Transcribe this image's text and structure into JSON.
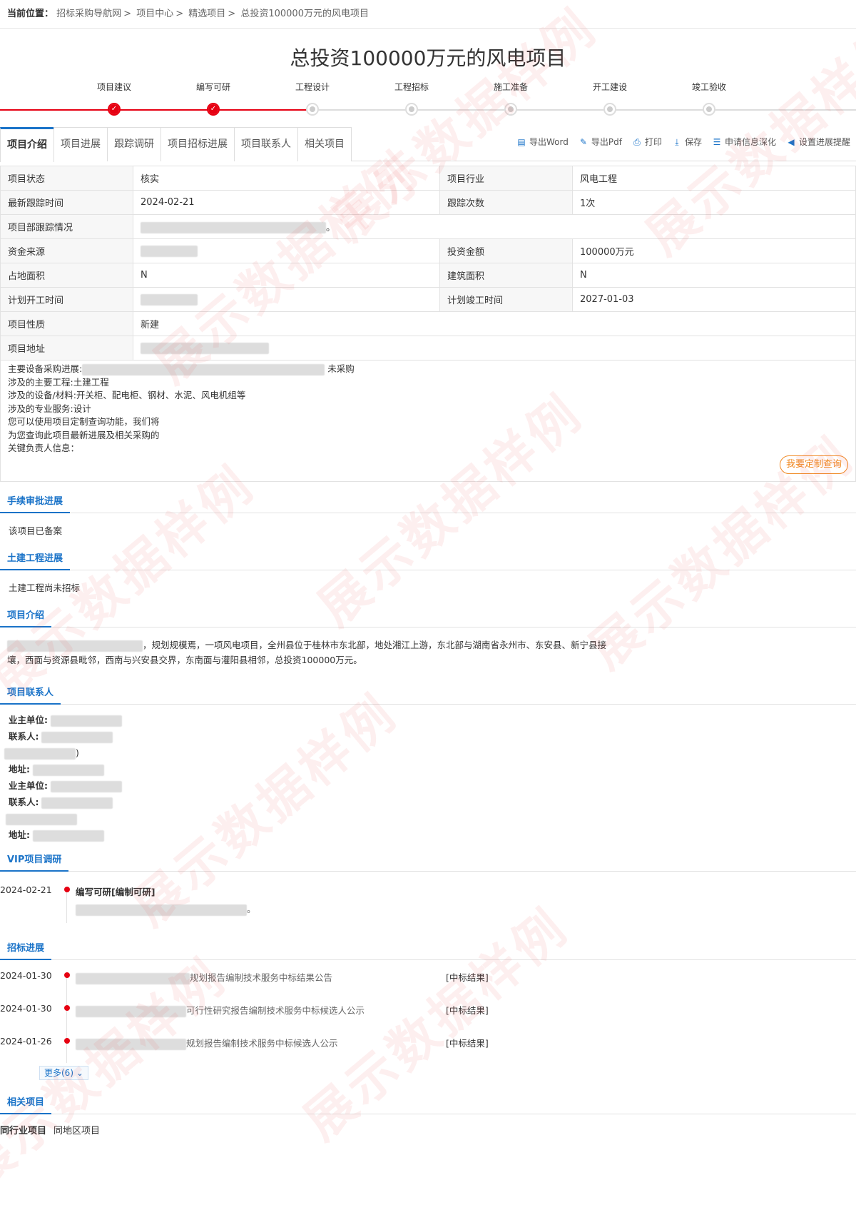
{
  "breadcrumb": {
    "prefix": "当前位置：",
    "items": [
      "招标采购导航网",
      "项目中心",
      "精选项目",
      "总投资100000万元的风电项目"
    ]
  },
  "page_title": "总投资100000万元的风电项目",
  "stepper": {
    "steps": [
      {
        "label": "项目建议",
        "done": true
      },
      {
        "label": "编写可研",
        "done": true
      },
      {
        "label": "工程设计",
        "done": false
      },
      {
        "label": "工程招标",
        "done": false
      },
      {
        "label": "施工准备",
        "done": false
      },
      {
        "label": "开工建设",
        "done": false
      },
      {
        "label": "竣工验收",
        "done": false
      }
    ],
    "completed_count": 2
  },
  "tabs": [
    {
      "label": "项目介绍",
      "active": true
    },
    {
      "label": "项目进展",
      "active": false
    },
    {
      "label": "跟踪调研",
      "active": false
    },
    {
      "label": "项目招标进展",
      "active": false
    },
    {
      "label": "项目联系人",
      "active": false
    },
    {
      "label": "相关项目",
      "active": false
    }
  ],
  "tools": [
    {
      "label": "导出Word",
      "icon": "word-icon"
    },
    {
      "label": "导出Pdf",
      "icon": "pdf-icon"
    },
    {
      "label": "打印",
      "icon": "print-icon"
    },
    {
      "label": "保存",
      "icon": "save-icon"
    },
    {
      "label": "申请信息深化",
      "icon": "apply-icon"
    },
    {
      "label": "设置进展提醒",
      "icon": "speaker-icon"
    }
  ],
  "info": {
    "status_k": "项目状态",
    "status_v": "核实",
    "industry_k": "项目行业",
    "industry_v": "风电工程",
    "track_time_k": "最新跟踪时间",
    "track_time_v": "2024-02-21",
    "track_count_k": "跟踪次数",
    "track_count_v": "1次",
    "track_info_k": "项目部跟踪情况",
    "track_info_suffix": "。",
    "fund_k": "资金来源",
    "invest_k": "投资金额",
    "invest_v": "100000万元",
    "land_k": "占地面积",
    "land_v": "N",
    "build_k": "建筑面积",
    "build_v": "N",
    "start_k": "计划开工时间",
    "end_k": "计划竣工时间",
    "end_v": "2027-01-03",
    "nature_k": "项目性质",
    "nature_v": "新建",
    "address_k": "项目地址"
  },
  "equipment": {
    "line1_prefix": "主要设备采购进展:",
    "line1_suffix": "未采购",
    "line2": "涉及的主要工程:土建工程",
    "line3": "涉及的设备/材料:开关柜、配电柜、钢材、水泥、风电机组等",
    "line4": "涉及的专业服务:设计",
    "line5": "您可以使用项目定制查询功能，我们将",
    "line6": "为您查询此项目最新进展及相关采购的",
    "line7": "关键负责人信息：",
    "custom_button": "我要定制查询"
  },
  "sections": {
    "approval_title": "手续审批进展",
    "approval_text": "该项目已备案",
    "civil_title": "土建工程进展",
    "civil_text": "土建工程尚未招标",
    "intro_title": "项目介绍",
    "intro_text_1": "，规划规模焉，一项风电项目，全州县位于桂林市东北部，地处湘江上游，东北部与湖南省永州市、东安县、新宁县接",
    "intro_text_2": "壤，西面与资源县毗邻，西南与兴安县交界，东南面与灌阳县相邻，总投资100000万元。",
    "contacts_title": "项目联系人",
    "vip_title": "VIP项目调研",
    "bid_title": "招标进展",
    "related_title": "相关项目"
  },
  "contacts": {
    "owner_label": "业主单位:",
    "person_label": "联系人:",
    "address_label": "地址:",
    "paren_close": ")"
  },
  "vip": {
    "date": "2024-02-21",
    "title": "编写可研[编制可研]",
    "suffix": "。"
  },
  "bids": [
    {
      "date": "2024-01-30",
      "text": "规划报告编制技术服务中标结果公告",
      "tag": "[中标结果]"
    },
    {
      "date": "2024-01-30",
      "text": "可行性研究报告编制技术服务中标候选人公示",
      "tag": "[中标结果]"
    },
    {
      "date": "2024-01-26",
      "text": "规划报告编制技术服务中标候选人公示",
      "tag": "[中标结果]"
    }
  ],
  "more_button": "更多(6)",
  "related_tabs": [
    "同行业项目",
    "同地区项目"
  ],
  "watermark": "展示数据样例",
  "colors": {
    "accent": "#1a73c8",
    "progress": "#e60012",
    "orange": "#f08a24"
  }
}
